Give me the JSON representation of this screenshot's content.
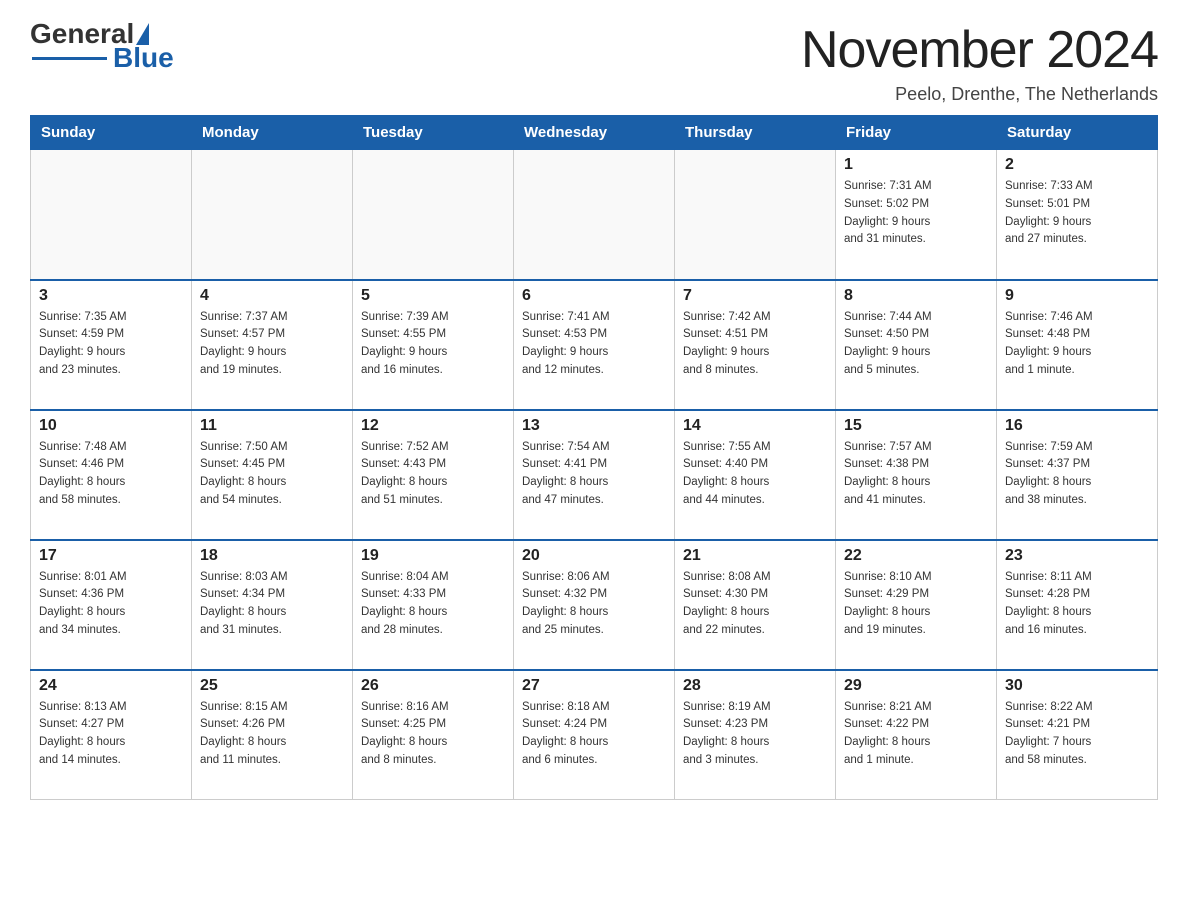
{
  "header": {
    "logo_text_black": "General",
    "logo_text_blue": "Blue",
    "month_title": "November 2024",
    "location": "Peelo, Drenthe, The Netherlands"
  },
  "weekdays": [
    "Sunday",
    "Monday",
    "Tuesday",
    "Wednesday",
    "Thursday",
    "Friday",
    "Saturday"
  ],
  "weeks": [
    [
      {
        "day": "",
        "info": ""
      },
      {
        "day": "",
        "info": ""
      },
      {
        "day": "",
        "info": ""
      },
      {
        "day": "",
        "info": ""
      },
      {
        "day": "",
        "info": ""
      },
      {
        "day": "1",
        "info": "Sunrise: 7:31 AM\nSunset: 5:02 PM\nDaylight: 9 hours\nand 31 minutes."
      },
      {
        "day": "2",
        "info": "Sunrise: 7:33 AM\nSunset: 5:01 PM\nDaylight: 9 hours\nand 27 minutes."
      }
    ],
    [
      {
        "day": "3",
        "info": "Sunrise: 7:35 AM\nSunset: 4:59 PM\nDaylight: 9 hours\nand 23 minutes."
      },
      {
        "day": "4",
        "info": "Sunrise: 7:37 AM\nSunset: 4:57 PM\nDaylight: 9 hours\nand 19 minutes."
      },
      {
        "day": "5",
        "info": "Sunrise: 7:39 AM\nSunset: 4:55 PM\nDaylight: 9 hours\nand 16 minutes."
      },
      {
        "day": "6",
        "info": "Sunrise: 7:41 AM\nSunset: 4:53 PM\nDaylight: 9 hours\nand 12 minutes."
      },
      {
        "day": "7",
        "info": "Sunrise: 7:42 AM\nSunset: 4:51 PM\nDaylight: 9 hours\nand 8 minutes."
      },
      {
        "day": "8",
        "info": "Sunrise: 7:44 AM\nSunset: 4:50 PM\nDaylight: 9 hours\nand 5 minutes."
      },
      {
        "day": "9",
        "info": "Sunrise: 7:46 AM\nSunset: 4:48 PM\nDaylight: 9 hours\nand 1 minute."
      }
    ],
    [
      {
        "day": "10",
        "info": "Sunrise: 7:48 AM\nSunset: 4:46 PM\nDaylight: 8 hours\nand 58 minutes."
      },
      {
        "day": "11",
        "info": "Sunrise: 7:50 AM\nSunset: 4:45 PM\nDaylight: 8 hours\nand 54 minutes."
      },
      {
        "day": "12",
        "info": "Sunrise: 7:52 AM\nSunset: 4:43 PM\nDaylight: 8 hours\nand 51 minutes."
      },
      {
        "day": "13",
        "info": "Sunrise: 7:54 AM\nSunset: 4:41 PM\nDaylight: 8 hours\nand 47 minutes."
      },
      {
        "day": "14",
        "info": "Sunrise: 7:55 AM\nSunset: 4:40 PM\nDaylight: 8 hours\nand 44 minutes."
      },
      {
        "day": "15",
        "info": "Sunrise: 7:57 AM\nSunset: 4:38 PM\nDaylight: 8 hours\nand 41 minutes."
      },
      {
        "day": "16",
        "info": "Sunrise: 7:59 AM\nSunset: 4:37 PM\nDaylight: 8 hours\nand 38 minutes."
      }
    ],
    [
      {
        "day": "17",
        "info": "Sunrise: 8:01 AM\nSunset: 4:36 PM\nDaylight: 8 hours\nand 34 minutes."
      },
      {
        "day": "18",
        "info": "Sunrise: 8:03 AM\nSunset: 4:34 PM\nDaylight: 8 hours\nand 31 minutes."
      },
      {
        "day": "19",
        "info": "Sunrise: 8:04 AM\nSunset: 4:33 PM\nDaylight: 8 hours\nand 28 minutes."
      },
      {
        "day": "20",
        "info": "Sunrise: 8:06 AM\nSunset: 4:32 PM\nDaylight: 8 hours\nand 25 minutes."
      },
      {
        "day": "21",
        "info": "Sunrise: 8:08 AM\nSunset: 4:30 PM\nDaylight: 8 hours\nand 22 minutes."
      },
      {
        "day": "22",
        "info": "Sunrise: 8:10 AM\nSunset: 4:29 PM\nDaylight: 8 hours\nand 19 minutes."
      },
      {
        "day": "23",
        "info": "Sunrise: 8:11 AM\nSunset: 4:28 PM\nDaylight: 8 hours\nand 16 minutes."
      }
    ],
    [
      {
        "day": "24",
        "info": "Sunrise: 8:13 AM\nSunset: 4:27 PM\nDaylight: 8 hours\nand 14 minutes."
      },
      {
        "day": "25",
        "info": "Sunrise: 8:15 AM\nSunset: 4:26 PM\nDaylight: 8 hours\nand 11 minutes."
      },
      {
        "day": "26",
        "info": "Sunrise: 8:16 AM\nSunset: 4:25 PM\nDaylight: 8 hours\nand 8 minutes."
      },
      {
        "day": "27",
        "info": "Sunrise: 8:18 AM\nSunset: 4:24 PM\nDaylight: 8 hours\nand 6 minutes."
      },
      {
        "day": "28",
        "info": "Sunrise: 8:19 AM\nSunset: 4:23 PM\nDaylight: 8 hours\nand 3 minutes."
      },
      {
        "day": "29",
        "info": "Sunrise: 8:21 AM\nSunset: 4:22 PM\nDaylight: 8 hours\nand 1 minute."
      },
      {
        "day": "30",
        "info": "Sunrise: 8:22 AM\nSunset: 4:21 PM\nDaylight: 7 hours\nand 58 minutes."
      }
    ]
  ]
}
